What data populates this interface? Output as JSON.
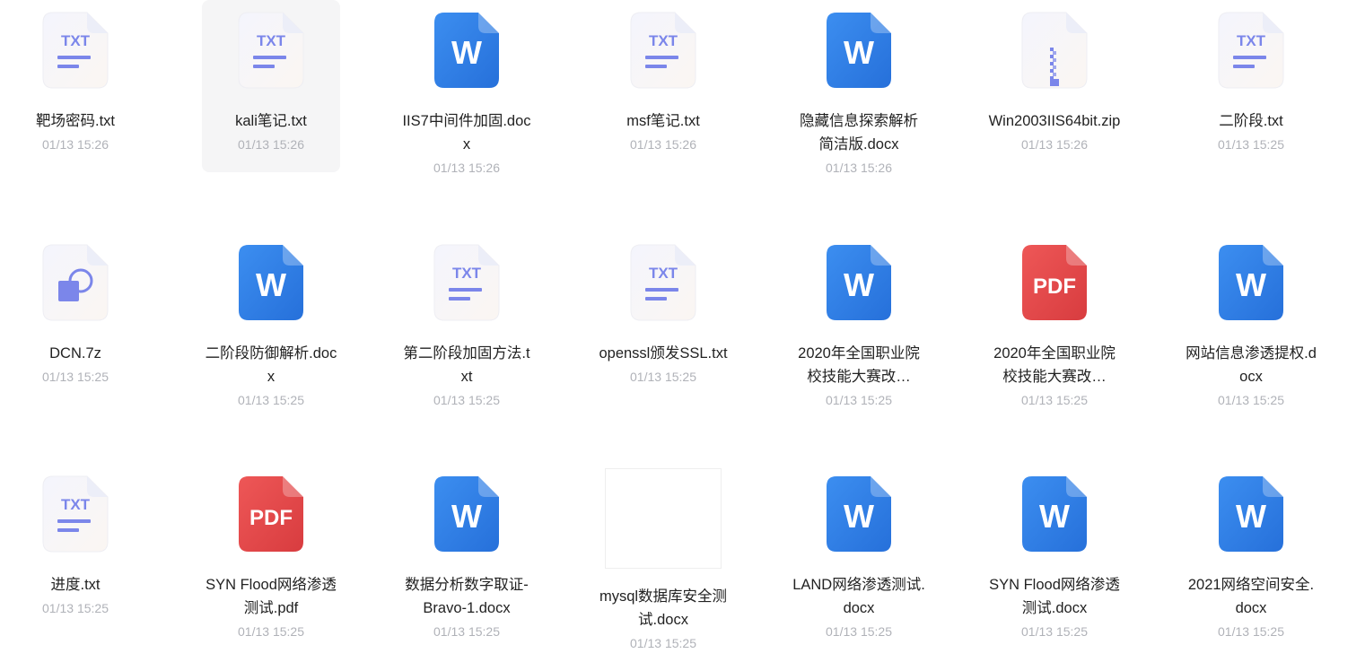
{
  "files": [
    {
      "name": "靶场密码.txt",
      "time": "01/13 15:26",
      "type": "txt"
    },
    {
      "name": "kali笔记.txt",
      "time": "01/13 15:26",
      "type": "txt",
      "hovered": true
    },
    {
      "name": "IIS7中间件加固.docx",
      "time": "01/13 15:26",
      "type": "docx"
    },
    {
      "name": "msf笔记.txt",
      "time": "01/13 15:26",
      "type": "txt"
    },
    {
      "name": "隐藏信息探索解析简洁版.docx",
      "time": "01/13 15:26",
      "type": "docx"
    },
    {
      "name": "Win2003IIS64bit.zip",
      "time": "01/13 15:26",
      "type": "zip"
    },
    {
      "name": "二阶段.txt",
      "time": "01/13 15:25",
      "type": "txt"
    },
    {
      "name": "DCN.7z",
      "time": "01/13 15:25",
      "type": "7z"
    },
    {
      "name": "二阶段防御解析.docx",
      "time": "01/13 15:25",
      "type": "docx"
    },
    {
      "name": "第二阶段加固方法.txt",
      "time": "01/13 15:25",
      "type": "txt"
    },
    {
      "name": "openssl颁发SSL.txt",
      "time": "01/13 15:25",
      "type": "txt"
    },
    {
      "name": "2020年全国职业院校技能大赛改…",
      "time": "01/13 15:25",
      "type": "docx"
    },
    {
      "name": "2020年全国职业院校技能大赛改…",
      "time": "01/13 15:25",
      "type": "pdf"
    },
    {
      "name": "网站信息渗透提权.docx",
      "time": "01/13 15:25",
      "type": "docx"
    },
    {
      "name": "进度.txt",
      "time": "01/13 15:25",
      "type": "txt"
    },
    {
      "name": "SYN Flood网络渗透测试.pdf",
      "time": "01/13 15:25",
      "type": "pdf"
    },
    {
      "name": "数据分析数字取证-Bravo-1.docx",
      "time": "01/13 15:25",
      "type": "docx"
    },
    {
      "name": "mysql数据库安全测试.docx",
      "time": "01/13 15:25",
      "type": "thumb"
    },
    {
      "name": "LAND网络渗透测试.docx",
      "time": "01/13 15:25",
      "type": "docx"
    },
    {
      "name": "SYN Flood网络渗透测试.docx",
      "time": "01/13 15:25",
      "type": "docx"
    },
    {
      "name": "2021网络空间安全.docx",
      "time": "01/13 15:25",
      "type": "docx"
    }
  ],
  "icon_labels": {
    "txt": "TXT",
    "docx": "W",
    "pdf": "PDF"
  },
  "icon_names": {
    "txt": "txt-file-icon",
    "docx": "word-file-icon",
    "pdf": "pdf-file-icon",
    "zip": "zip-file-icon",
    "7z": "archive-7z-file-icon",
    "thumb": "document-thumbnail"
  },
  "colors": {
    "word": "#2f7de1",
    "pdf": "#e2484a",
    "txt_accent": "#7b86ea",
    "zip_accent": "#7b86ea",
    "archive_accent": "#7b86ea"
  }
}
